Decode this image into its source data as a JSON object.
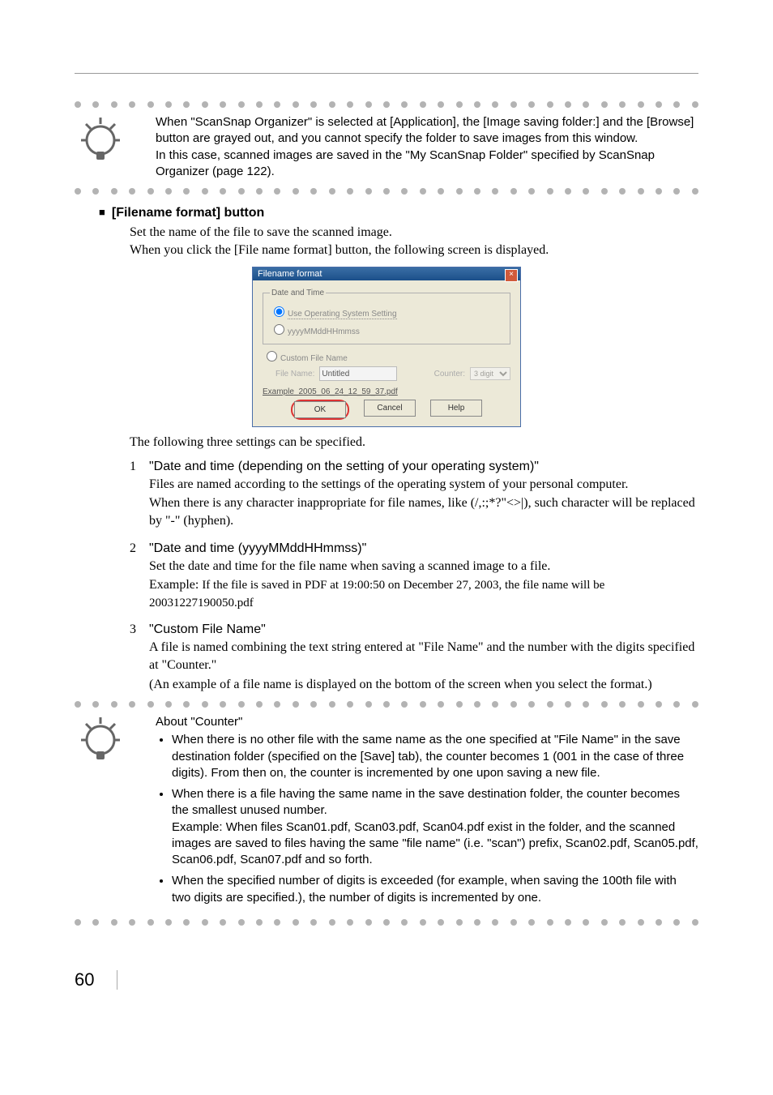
{
  "tip1": {
    "p1": "When \"ScanSnap Organizer\" is selected at [Application], the [Image saving folder:] and the [Browse] button are grayed out, and you cannot specify the folder to save images from this window.",
    "p2": "In this case, scanned images are saved in the \"My ScanSnap Folder\" specified by ScanSnap Organizer (page 122)."
  },
  "section_button": "[Filename format] button",
  "intro1": "Set the name of the file to save the scanned image.",
  "intro2": "When you click the [File name format] button, the following screen is displayed.",
  "dialog": {
    "title": "Filename format",
    "group1": "Date and Time",
    "opt1": "Use Operating System Setting",
    "opt2": "yyyyMMddHHmmss",
    "group2_opt": "Custom File Name",
    "file_label": "File Name:",
    "file_value": "Untitled",
    "counter_label": "Counter:",
    "counter_value": "3 digit",
    "example_label": "Example",
    "example_value": "2005_06_24_12_59_37.pdf",
    "ok": "OK",
    "cancel": "Cancel",
    "help": "Help"
  },
  "after_dialog": "The following three settings can be specified.",
  "item1": {
    "title": "\"Date and time (depending on the setting of your operating system)\"",
    "p1": "Files are named according to the settings of the operating system of your personal computer.",
    "p2": "When there is any character inappropriate for file names, like (/,:;*?\"<>|), such character will be replaced by \"-\" (hyphen)."
  },
  "item2": {
    "title": "\"Date and time (yyyyMMddHHmmss)\"",
    "p1": "Set the date and time for the file name when saving a scanned image to a file.",
    "p2_lead": "Example: ",
    "p2_rest": "If the file is saved in PDF at 19:00:50 on December 27, 2003, the file name will be 20031227190050.pdf"
  },
  "item3": {
    "title": "\"Custom File Name\"",
    "p1": "A file is named combining the text string entered at \"File Name\" and the number with the digits specified at \"Counter.\"",
    "p2": "(An example of a file name is displayed on the bottom of the screen when you select the format.)"
  },
  "about": {
    "heading": "About \"Counter\"",
    "b1": "When there is no other file with the same name as the one specified at \"File Name\" in the save destination folder (specified on the [Save] tab), the counter becomes 1 (001 in the case of three digits). From then on, the counter is incremented by one upon saving a new file.",
    "b2a": "When there is a file having the same name in the save destination folder, the counter becomes the smallest unused number.",
    "b2b": "Example: When files Scan01.pdf, Scan03.pdf, Scan04.pdf exist in the folder, and the scanned images are saved to files having the same \"file name\" (i.e. \"scan\") prefix, Scan02.pdf, Scan05.pdf, Scan06.pdf, Scan07.pdf and so forth.",
    "b3": " When the specified number of digits is exceeded (for example, when saving the 100th file with two digits are specified.), the number of digits is incremented by one."
  },
  "page_number": "60"
}
